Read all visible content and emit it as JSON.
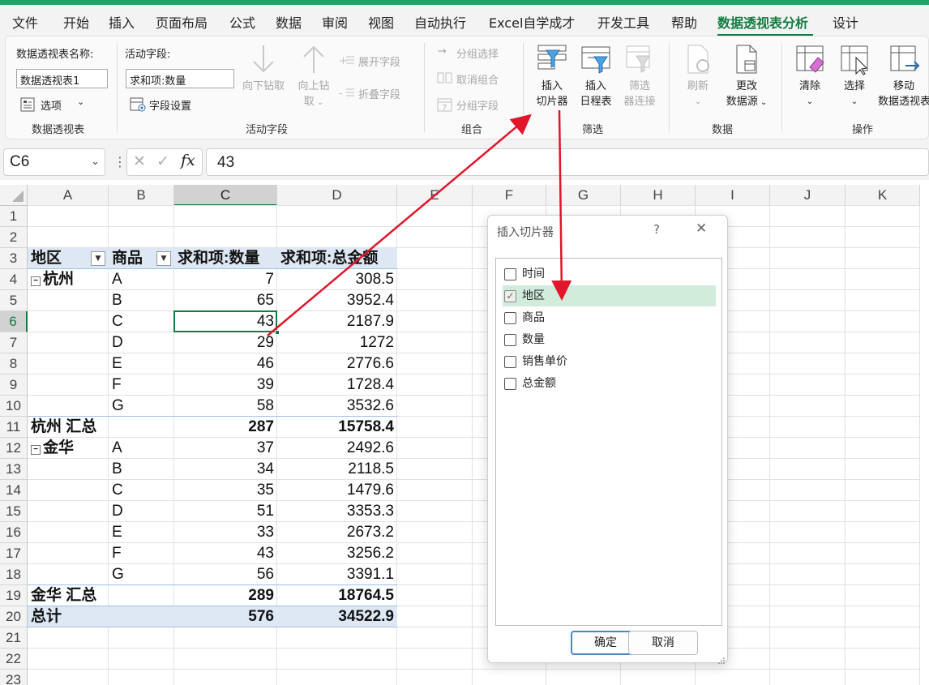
{
  "menu": {
    "tabs": [
      "文件",
      "开始",
      "插入",
      "页面布局",
      "公式",
      "数据",
      "审阅",
      "视图",
      "自动执行",
      "Excel自学成才",
      "开发工具",
      "帮助",
      "数据透视表分析",
      "设计"
    ],
    "active_tab": "数据透视表分析"
  },
  "ribbon": {
    "pivot_group": {
      "name_label": "数据透视表名称:",
      "name_value": "数据透视表1",
      "options_label": "选项",
      "group_label": "数据透视表"
    },
    "active_field_group": {
      "field_label": "活动字段:",
      "field_value": "求和项:数量",
      "field_settings_label": "字段设置",
      "drill_down_label": "向下钻取",
      "drill_up_label_1": "向上钻",
      "drill_up_label_2": "取",
      "expand_label": "展开字段",
      "collapse_label": "折叠字段",
      "group_label": "活动字段"
    },
    "group_group": {
      "group_selection": "分组选择",
      "ungroup": "取消组合",
      "group_field": "分组字段",
      "group_label": "组合"
    },
    "filter_group": {
      "insert_slicer_1": "插入",
      "insert_slicer_2": "切片器",
      "insert_timeline_1": "插入",
      "insert_timeline_2": "日程表",
      "filter_conn_1": "筛选",
      "filter_conn_2": "器连接",
      "group_label": "筛选"
    },
    "data_group": {
      "refresh": "刷新",
      "change_source_1": "更改",
      "change_source_2": "数据源",
      "group_label": "数据"
    },
    "actions_group": {
      "clear": "清除",
      "select": "选择",
      "move_1": "移动",
      "move_2": "数据透视表",
      "group_label": "操作"
    }
  },
  "formula_bar": {
    "name_box": "C6",
    "fx": "fx",
    "value": "43"
  },
  "grid": {
    "columns": [
      "A",
      "B",
      "C",
      "D",
      "E",
      "F",
      "G",
      "H",
      "I",
      "J",
      "K"
    ],
    "rows": [
      "1",
      "2",
      "3",
      "4",
      "5",
      "6",
      "7",
      "8",
      "9",
      "10",
      "11",
      "12",
      "13",
      "14",
      "15",
      "16",
      "17",
      "18",
      "19",
      "20",
      "21",
      "22",
      "23"
    ],
    "selected_column": "C",
    "selected_row": "6",
    "pivot": {
      "headers": [
        "地区",
        "商品",
        "求和项:数量",
        "求和项:总金额"
      ],
      "groups": [
        {
          "region": "杭州",
          "items": [
            {
              "product": "A",
              "qty": "7",
              "amount": "308.5"
            },
            {
              "product": "B",
              "qty": "65",
              "amount": "3952.4"
            },
            {
              "product": "C",
              "qty": "43",
              "amount": "2187.9"
            },
            {
              "product": "D",
              "qty": "29",
              "amount": "1272"
            },
            {
              "product": "E",
              "qty": "46",
              "amount": "2776.6"
            },
            {
              "product": "F",
              "qty": "39",
              "amount": "1728.4"
            },
            {
              "product": "G",
              "qty": "58",
              "amount": "3532.6"
            }
          ],
          "subtotal_label": "杭州 汇总",
          "subtotal_qty": "287",
          "subtotal_amount": "15758.4"
        },
        {
          "region": "金华",
          "items": [
            {
              "product": "A",
              "qty": "37",
              "amount": "2492.6"
            },
            {
              "product": "B",
              "qty": "34",
              "amount": "2118.5"
            },
            {
              "product": "C",
              "qty": "35",
              "amount": "1479.6"
            },
            {
              "product": "D",
              "qty": "51",
              "amount": "3353.3"
            },
            {
              "product": "E",
              "qty": "33",
              "amount": "2673.2"
            },
            {
              "product": "F",
              "qty": "43",
              "amount": "3256.2"
            },
            {
              "product": "G",
              "qty": "56",
              "amount": "3391.1"
            }
          ],
          "subtotal_label": "金华 汇总",
          "subtotal_qty": "289",
          "subtotal_amount": "18764.5"
        }
      ],
      "total_label": "总计",
      "total_qty": "576",
      "total_amount": "34522.9"
    }
  },
  "dialog": {
    "title": "插入切片器",
    "help": "?",
    "close": "✕",
    "fields": [
      {
        "label": "时间",
        "checked": false
      },
      {
        "label": "地区",
        "checked": true
      },
      {
        "label": "商品",
        "checked": false
      },
      {
        "label": "数量",
        "checked": false
      },
      {
        "label": "销售单价",
        "checked": false
      },
      {
        "label": "总金额",
        "checked": false
      }
    ],
    "ok": "确定",
    "cancel": "取消"
  },
  "colors": {
    "accent": "#107c41",
    "pivot_band": "#dde8f4",
    "highlight": "#d2ecdc",
    "arrow": "#e0162b"
  }
}
